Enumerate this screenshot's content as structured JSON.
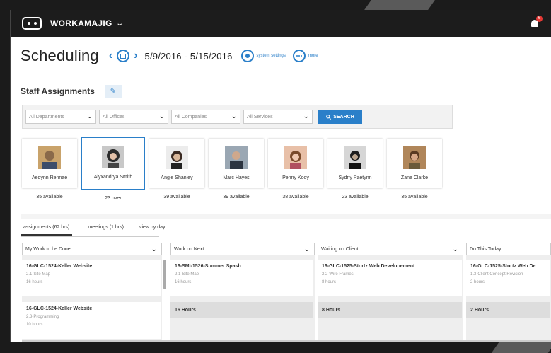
{
  "app": {
    "brand": "WORKAMAJIG",
    "notifications": "6"
  },
  "header": {
    "title": "Scheduling",
    "date_range": "5/9/2016 - 5/15/2016",
    "system_settings": "system settings",
    "more": "more"
  },
  "section": {
    "title": "Staff Assignments"
  },
  "filters": {
    "departments": "All Departments",
    "offices": "All Offices",
    "companies": "All Companies",
    "services": "All Services",
    "search": "SEARCH"
  },
  "people": [
    {
      "name": "Aedynn Rennae",
      "availability": "35 available"
    },
    {
      "name": "Alyxandrya Smith",
      "availability": "23 over"
    },
    {
      "name": "Angie Shanley",
      "availability": "39 available"
    },
    {
      "name": "Marc Hayes",
      "availability": "39 available"
    },
    {
      "name": "Penny Kooy",
      "availability": "38 available"
    },
    {
      "name": "Sydny Paetynn",
      "availability": "23 available"
    },
    {
      "name": "Zane Clarke",
      "availability": "35 available"
    }
  ],
  "tabs": [
    {
      "label": "assignments (62 hrs)"
    },
    {
      "label": "meetings (1 hrs)"
    },
    {
      "label": "view by day"
    }
  ],
  "columns": [
    {
      "header": "My Work to be Done",
      "tasks": [
        {
          "title": "16-GLC-1524-Keller Website",
          "sub": "2.1-Site Map",
          "hours": "16 hours"
        },
        {
          "title": "16-GLC-1524-Keller Website",
          "sub": "2.3-Programming",
          "hours": "10 hours"
        }
      ]
    },
    {
      "header": "Work on Next",
      "tasks": [
        {
          "title": "16-SMI-1526-Summer Spash",
          "sub": "2.1-Site Map",
          "hours": "16 hours"
        }
      ],
      "total": "16 Hours"
    },
    {
      "header": "Waiting on Client",
      "tasks": [
        {
          "title": "16-GLC-1525-Stortz Web Developement",
          "sub": "2.2-Wire Frames",
          "hours": "8 hours"
        }
      ],
      "total": "8 Hours"
    },
    {
      "header": "Do This Today",
      "tasks": [
        {
          "title": "16-GLC-1525-Stortz Web De",
          "sub": "1.3-Client Concept Revision",
          "hours": "2 hours"
        }
      ],
      "total": "2 Hours"
    }
  ],
  "icons": {
    "logo": "workamajig-logo-icon",
    "brand_menu": "chevron-down-icon",
    "notifications": "bell-icon",
    "prev": "chevron-left-icon",
    "calendar": "calendar-icon",
    "next": "chevron-right-icon",
    "settings": "gear-icon",
    "more": "more-icon",
    "edit": "pencil-icon",
    "search": "search-icon"
  },
  "colors": {
    "accent": "#2a7fc9",
    "topbar": "#1c1c1c",
    "alert": "#e53935"
  }
}
